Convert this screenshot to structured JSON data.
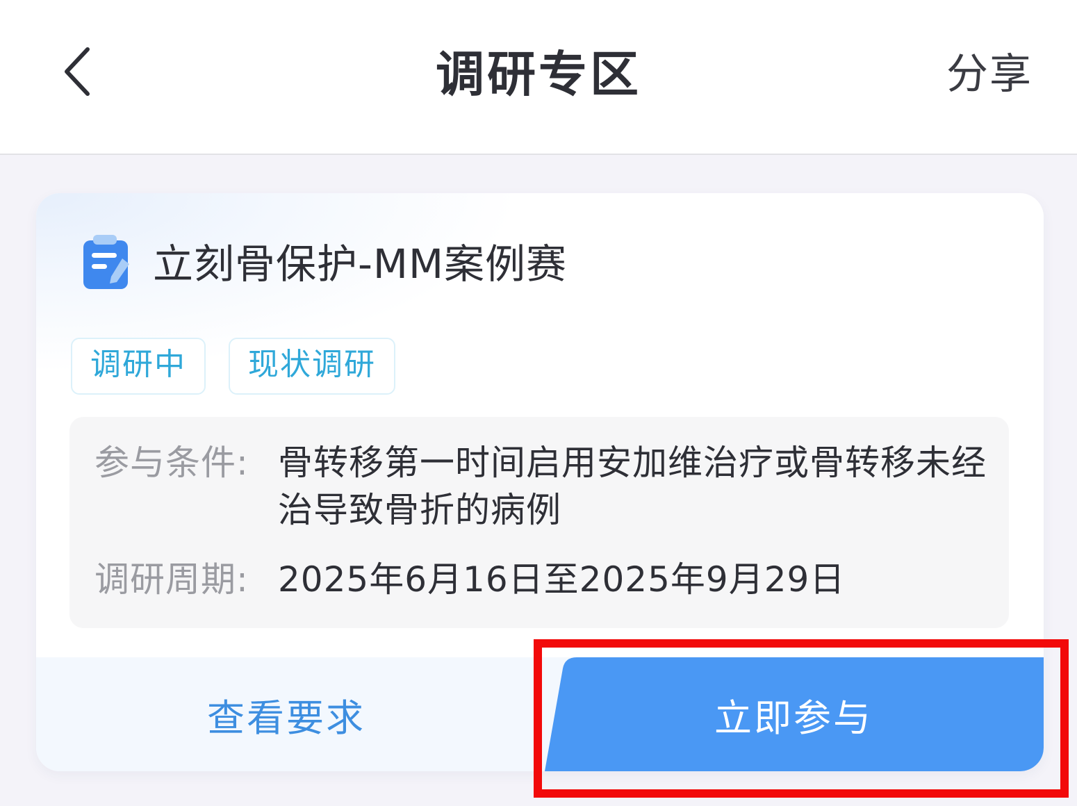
{
  "header": {
    "back_icon": "chevron-left-icon",
    "title": "调研专区",
    "share_label": "分享"
  },
  "card": {
    "icon": "clipboard-edit-icon",
    "title": "立刻骨保护-MM案例赛",
    "tags": [
      "调研中",
      "现状调研"
    ],
    "info": {
      "condition_label": "参与条件:",
      "condition_value": "骨转移第一时间启用安加维治疗或骨转移未经治导致骨折的病例",
      "period_label": "调研周期:",
      "period_value": "2025年6月16日至2025年9月29日"
    },
    "actions": {
      "view_requirements": "查看要求",
      "join_now": "立即参与"
    }
  },
  "colors": {
    "accent_blue": "#4a98f4",
    "tag_text": "#2fa8d9",
    "link_blue": "#3d8ee0",
    "highlight_red": "#f20a0a"
  }
}
